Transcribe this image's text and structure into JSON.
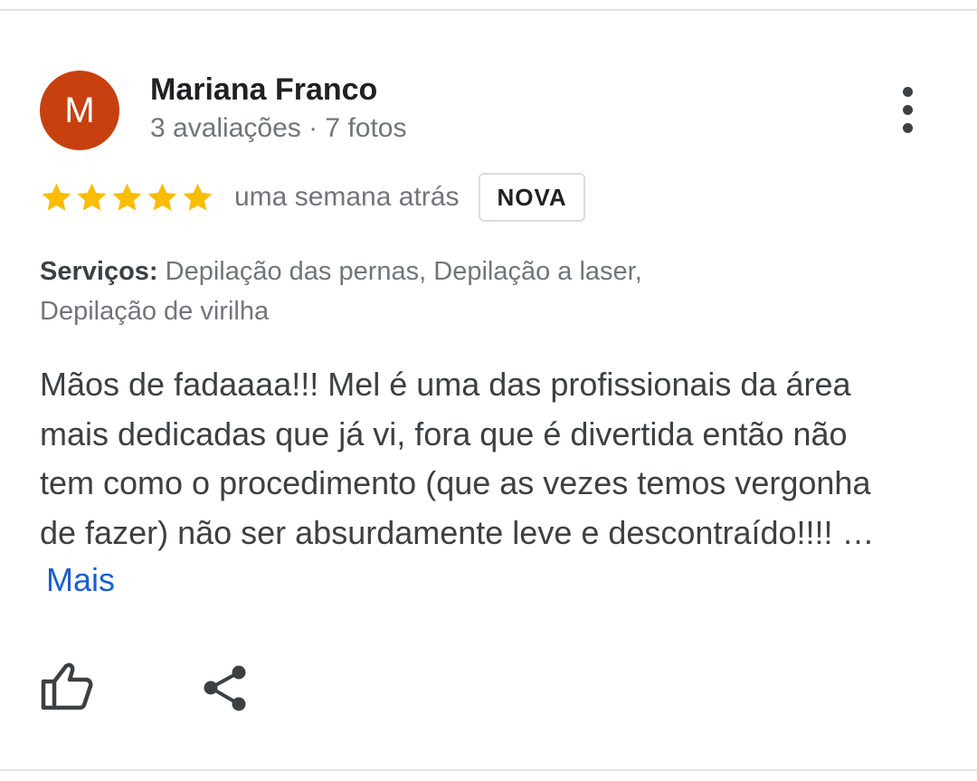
{
  "review": {
    "author": {
      "initial": "M",
      "name": "Mariana Franco",
      "meta": "3 avaliações · 7 fotos",
      "avatar_color": "#c8400f"
    },
    "rating": 5,
    "rating_max": 5,
    "star_color": "#fbbc04",
    "date": "uma semana atrás",
    "badge": "NOVA",
    "services": {
      "label": "Serviços:",
      "line1": " Depilação das pernas, Depilação a laser,",
      "line2": "Depilação de virilha"
    },
    "text_lines": [
      "Mãos de fadaaaa!!! Mel é uma das profissionais da área",
      "mais dedicadas que já vi, fora que é divertida então não",
      "tem como o procedimento (que as vezes temos vergonha",
      "de fazer) não ser absurdamente leve e descontraído!!!! …"
    ],
    "more_label": "Mais",
    "link_color": "#1a5fd0"
  },
  "icons": {
    "menu": "more-vert-icon",
    "like": "thumb-up-icon",
    "share": "share-icon",
    "star": "star-icon"
  }
}
